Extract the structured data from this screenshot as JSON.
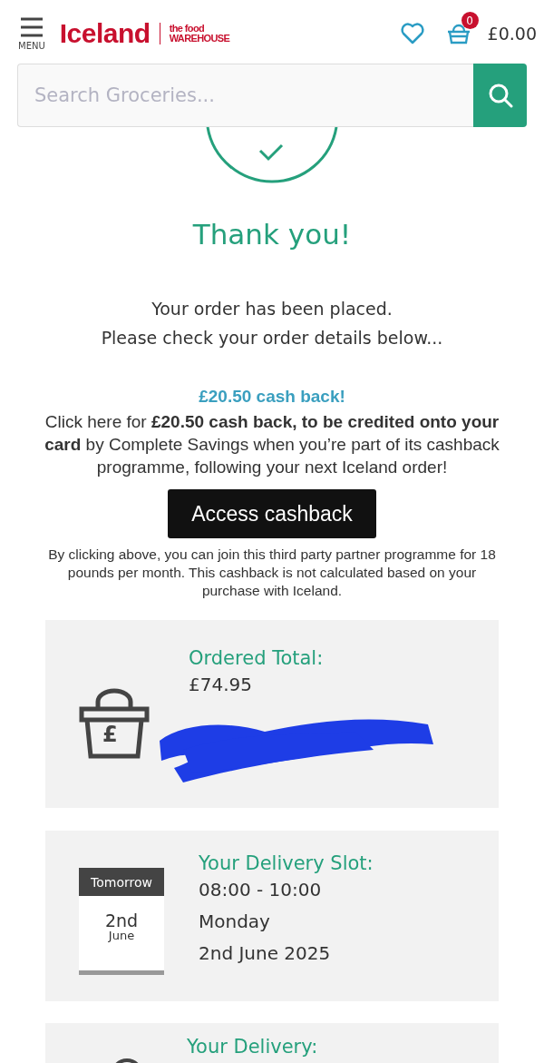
{
  "header": {
    "menu_label": "MENU",
    "logo": "Iceland",
    "sub_logo_top": "the food",
    "sub_logo_bottom": "WAREHOUSE",
    "basket_count": "0",
    "basket_total": "£0.00"
  },
  "search": {
    "placeholder": "Search Groceries..."
  },
  "confirmation": {
    "title": "Thank you!",
    "lines": [
      "Your order has been placed.",
      "Please check your order details below..."
    ]
  },
  "cashback": {
    "title": "£20.50 cash back!",
    "text": "Click here for **£20.50 cash back, to be credited onto your card** by Complete Savings when you’re part of its cashback programme, following your next Iceland order!",
    "button": "Access cashback",
    "disclaimer": "By clicking above, you can join this third party partner programme for 18 pounds per month. This cashback is not calculated based on your purchase with Iceland."
  },
  "ordered_total": {
    "label": "Ordered Total:",
    "value": "£74.95",
    "icon_symbol": "£",
    "redacted": true
  },
  "delivery_slot": {
    "label": "Your Delivery Slot:",
    "calendar_top": "Tomorrow",
    "calendar_day": "2nd",
    "calendar_month": "June",
    "lines": [
      "08:00 - 10:00",
      "Monday",
      "2nd June 2025"
    ]
  },
  "delivery": {
    "label": "Your Delivery:"
  }
}
